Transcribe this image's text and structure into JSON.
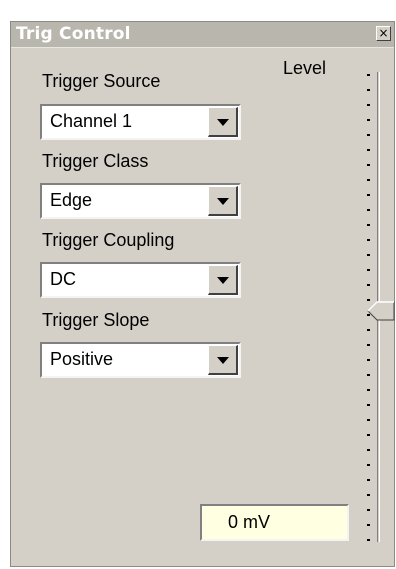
{
  "window": {
    "title": "Trig Control",
    "close_glyph": "×",
    "icons": {
      "close": "close-icon"
    }
  },
  "fields": [
    {
      "label": "Trigger Source",
      "value": "Channel 1"
    },
    {
      "label": "Trigger Class",
      "value": "Edge"
    },
    {
      "label": "Trigger Coupling",
      "value": "DC"
    },
    {
      "label": "Trigger Slope",
      "value": "Positive"
    }
  ],
  "level": {
    "label": "Level",
    "value_text": "0 mV",
    "slider_fraction": 0.5
  },
  "colors": {
    "panel": "#d4d0c8",
    "titlebar": "#b9b6ae",
    "readout": "#ffffe1"
  }
}
